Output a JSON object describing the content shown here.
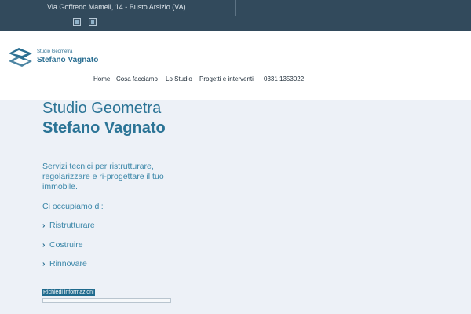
{
  "topbar": {
    "address": "Via Goffredo Mameli, 14 - Busto Arsizio (VA)",
    "social": [
      {
        "icon": "social-square-icon"
      },
      {
        "icon": "social-square-icon"
      }
    ]
  },
  "brand": {
    "small": "Studio Geometra",
    "name": "Stefano Vagnato"
  },
  "nav": {
    "items": [
      "Home",
      "Cosa facciamo",
      "Lo Studio",
      "Progetti e interventi",
      "0331 1353022"
    ]
  },
  "hero": {
    "title_line1": "Studio Geometra",
    "title_line2": "Stefano Vagnato",
    "description": "Servizi tecnici per ristrutturare, regolarizzare e ri-progettare il tuo immobile.",
    "intro": "Ci occupiamo di:",
    "services": [
      "Ristrutturare",
      "Costruire",
      "Rinnovare"
    ],
    "cta": "Richiedi informazioni"
  },
  "colors": {
    "topbar": "#324a5c",
    "brand": "#2b7496",
    "background": "#edf1f7"
  }
}
